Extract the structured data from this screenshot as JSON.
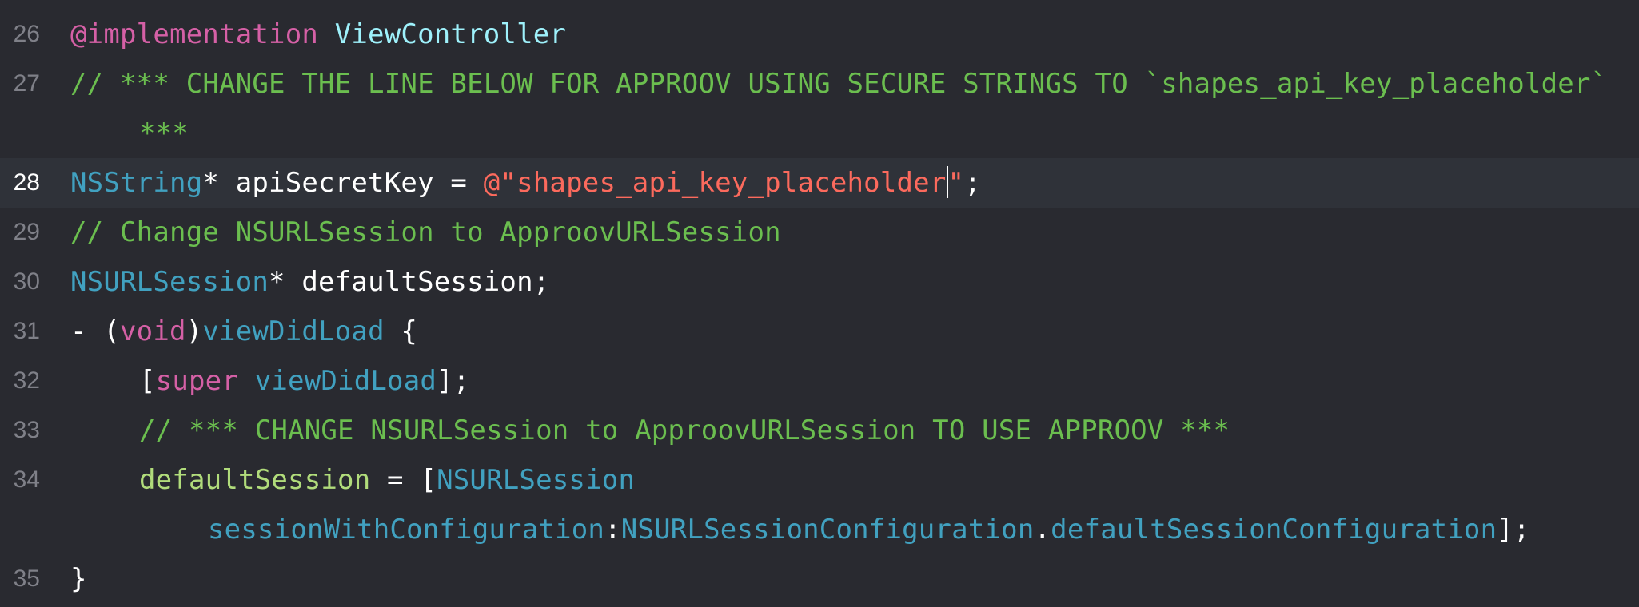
{
  "editor": {
    "lines": [
      {
        "number": "26",
        "tokens": [
          "@implementation",
          " ",
          "ViewController"
        ]
      },
      {
        "number": "27",
        "text": "// *** CHANGE THE LINE BELOW FOR APPROOV USING SECURE STRINGS TO `shapes_api_key_placeholder`",
        "wrap": "***"
      },
      {
        "number": "28",
        "tokens": [
          "NSString",
          "* apiSecretKey = ",
          "@\"shapes_api_key_placeholder",
          "\";"
        ]
      },
      {
        "number": "29",
        "text": "// Change NSURLSession to ApproovURLSession"
      },
      {
        "number": "30",
        "tokens": [
          "NSURLSession",
          "* defaultSession;"
        ]
      },
      {
        "number": "31",
        "tokens": [
          "- (",
          "void",
          ")",
          "viewDidLoad",
          " {"
        ]
      },
      {
        "number": "32",
        "tokens": [
          "[",
          "super",
          " ",
          "viewDidLoad",
          "];"
        ]
      },
      {
        "number": "33",
        "text": "// *** CHANGE NSURLSession to ApproovURLSession TO USE APPROOV ***"
      },
      {
        "number": "34",
        "tokens": [
          "defaultSession",
          " = [",
          "NSURLSession"
        ],
        "wrap_tokens": [
          "sessionWithConfiguration",
          ":",
          "NSURLSessionConfiguration",
          ".",
          "defaultSessionConfiguration",
          "];"
        ]
      },
      {
        "number": "35",
        "tokens": [
          "}"
        ]
      }
    ]
  },
  "colors": {
    "background": "#292a30",
    "current_line": "#2f3239",
    "comment": "#6bbe4f",
    "keyword": "#d560a6",
    "string": "#fc6a5d",
    "type": "#41a1c0",
    "plain": "#ffffff"
  }
}
